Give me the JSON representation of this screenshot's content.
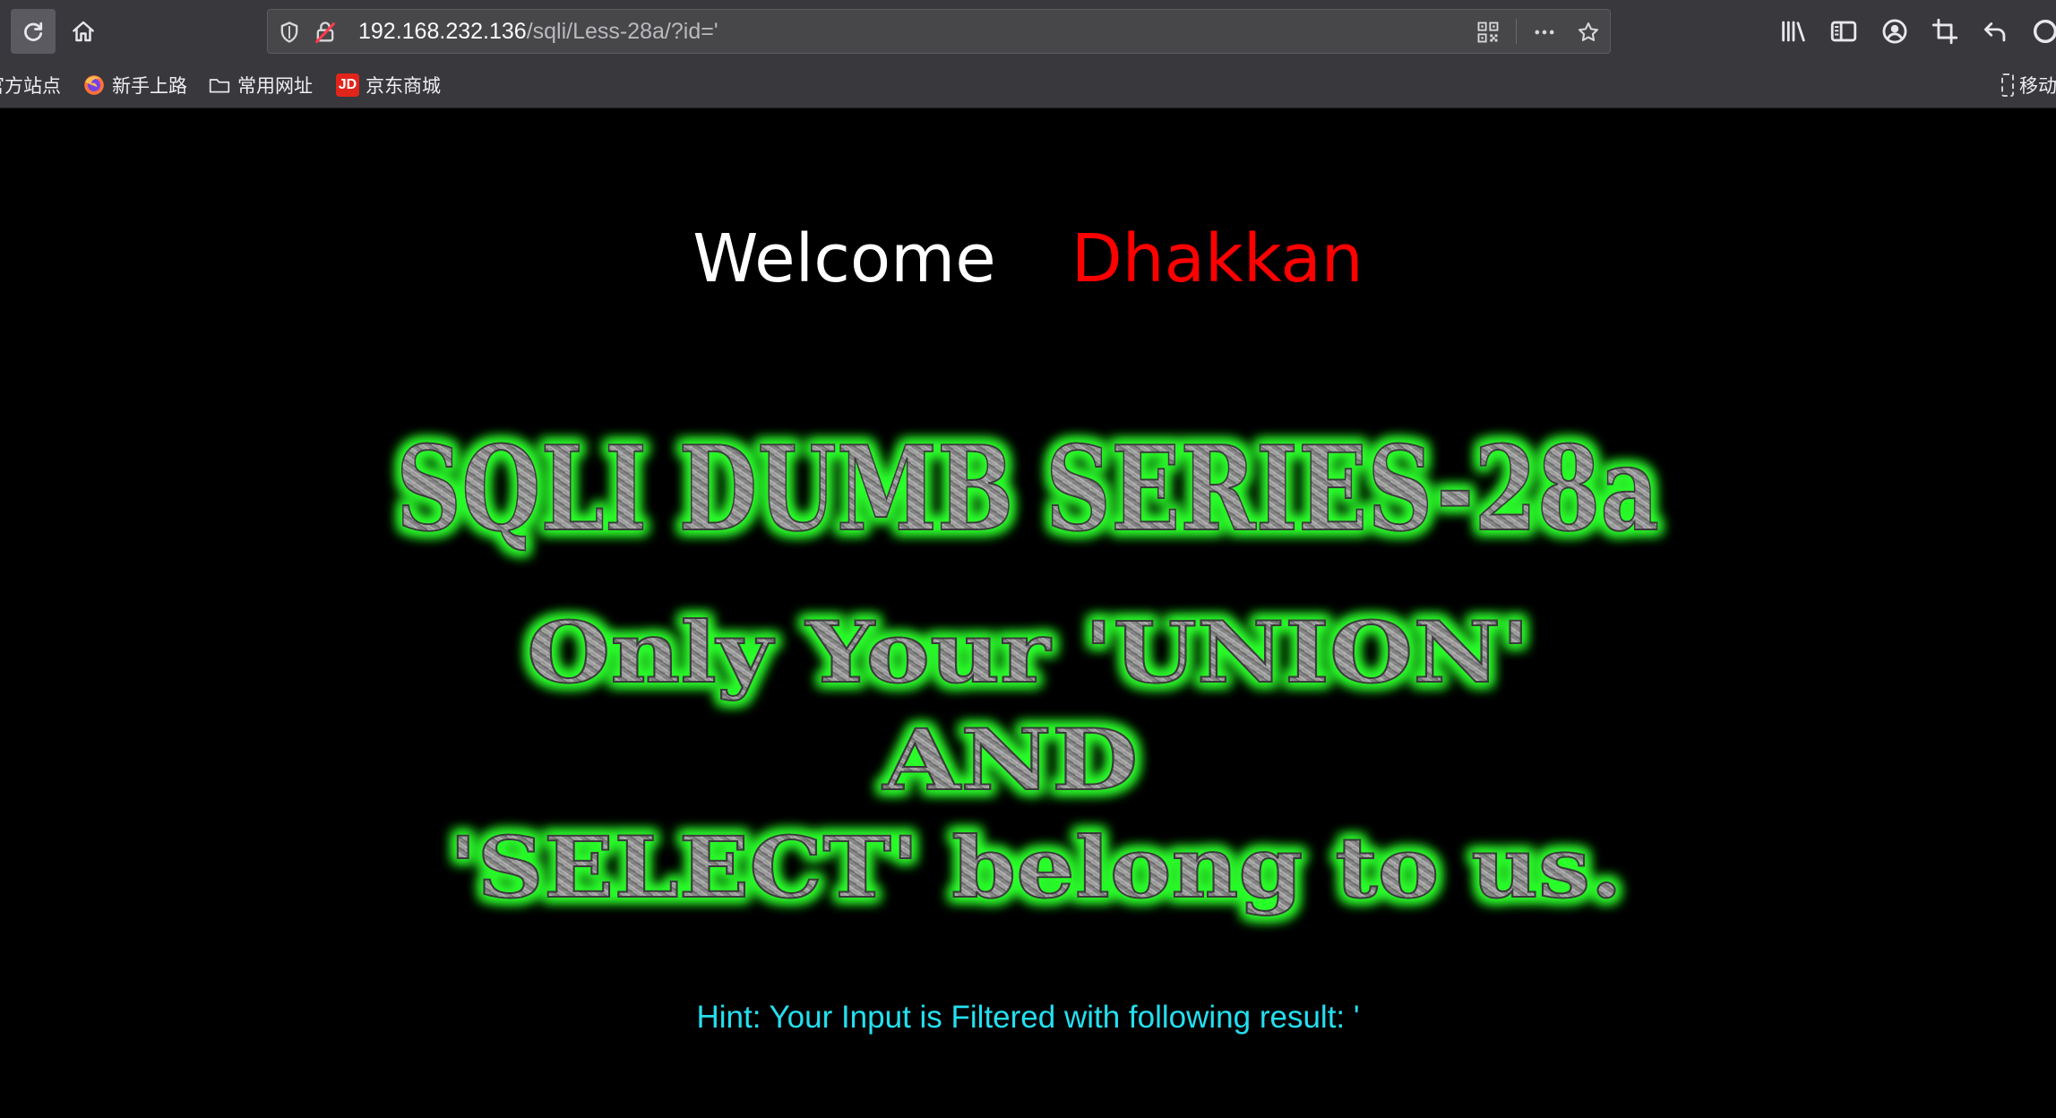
{
  "browser": {
    "url_host": "192.168.232.136",
    "url_path": "/sqli/Less-28a/?id='",
    "bookmarks": [
      {
        "label": "官方站点"
      },
      {
        "label": "新手上路"
      },
      {
        "label": "常用网址"
      },
      {
        "label": "京东商城",
        "badge": "JD"
      }
    ],
    "mobile_bookmarks_label": "移动"
  },
  "page": {
    "welcome_word": "Welcome",
    "welcome_name": "Dhakkan",
    "banner_title": "SQLI DUMB SERIES-28a",
    "banner_lines": [
      "Only Your 'UNION'",
      "AND",
      "'SELECT' belong to us."
    ],
    "hint_text": "Hint: Your Input is Filtered with following result: '"
  },
  "colors": {
    "background": "#000000",
    "welcome_word": "#ffffff",
    "welcome_name": "#ff0000",
    "banner_glow": "#22ff22",
    "banner_fill": "#8a8a8a",
    "hint": "#23e0f0",
    "chrome": "#38383d"
  }
}
